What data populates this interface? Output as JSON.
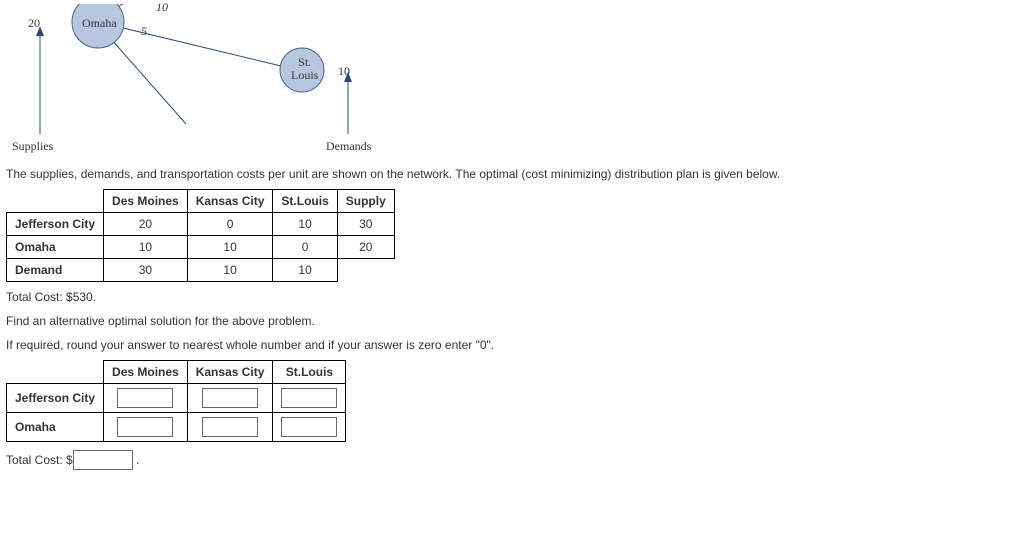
{
  "network": {
    "supply_value": "20",
    "demand_value": "10",
    "origin_label": "Omaha",
    "dest_label": "St.\nLouis",
    "edge_top_cost": "10",
    "edge_bottom_cost": "5",
    "supplies_caption": "Supplies",
    "demands_caption": "Demands"
  },
  "intro_text": "The supplies, demands, and transportation costs per unit are shown on the network. The optimal (cost minimizing) distribution plan is given below.",
  "table1": {
    "col_headers": [
      "Des Moines",
      "Kansas City",
      "St.Louis",
      "Supply"
    ],
    "rows": [
      {
        "label": "Jefferson City",
        "cells": [
          "20",
          "0",
          "10",
          "30"
        ]
      },
      {
        "label": "Omaha",
        "cells": [
          "10",
          "10",
          "0",
          "20"
        ]
      },
      {
        "label": "Demand",
        "cells": [
          "30",
          "10",
          "10",
          ""
        ]
      }
    ]
  },
  "total_cost_text": "Total Cost: $530.",
  "prompt1": "Find an alternative optimal solution for the above problem.",
  "prompt2": "If required, round your answer to nearest whole number and if your answer is zero enter \"0\".",
  "table2": {
    "col_headers": [
      "Des Moines",
      "Kansas City",
      "St.Louis"
    ],
    "row_labels": [
      "Jefferson City",
      "Omaha"
    ]
  },
  "total_cost_label": "Total Cost: $",
  "period": "."
}
